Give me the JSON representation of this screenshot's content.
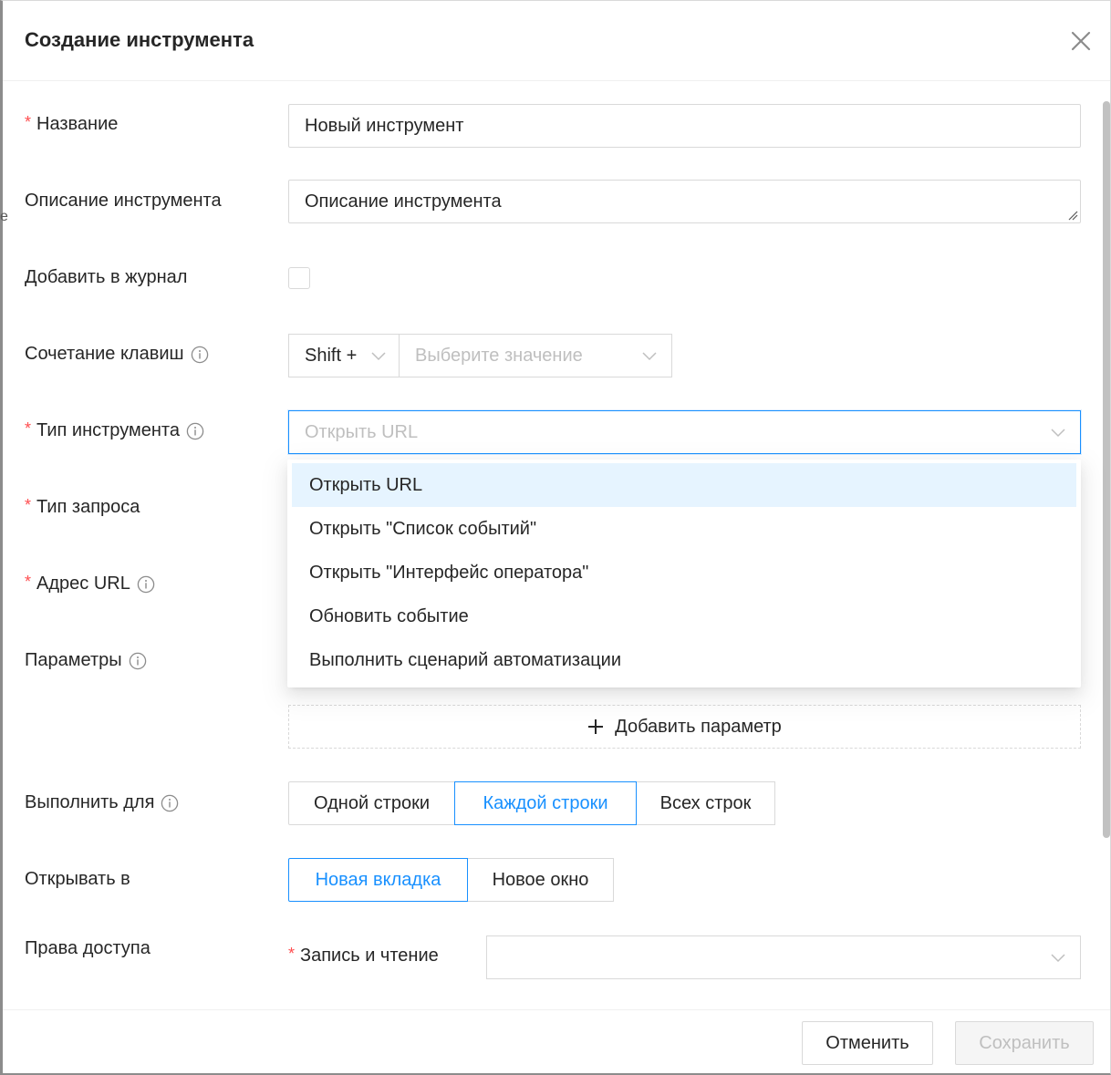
{
  "modal": {
    "title": "Создание инструмента"
  },
  "form": {
    "name": {
      "label": "Название",
      "value": "Новый инструмент"
    },
    "description": {
      "label": "Описание инструмента",
      "value": "Описание инструмента"
    },
    "add_to_log": {
      "label": "Добавить в журнал",
      "checked": false
    },
    "hotkey": {
      "label": "Сочетание клавиш",
      "modifier": "Shift +",
      "key_placeholder": "Выберите значение"
    },
    "tool_type": {
      "label": "Тип инструмента",
      "placeholder": "Открыть URL",
      "options": [
        "Открыть URL",
        "Открыть \"Список событий\"",
        "Открыть \"Интерфейс оператора\"",
        "Обновить событие",
        "Выполнить сценарий автоматизации"
      ],
      "highlighted_option": "Открыть URL"
    },
    "request_type": {
      "label": "Тип запроса"
    },
    "url": {
      "label": "Адрес URL"
    },
    "params": {
      "label": "Параметры",
      "add_button": "Добавить параметр"
    },
    "execute_for": {
      "label": "Выполнить для",
      "options": [
        "Одной строки",
        "Каждой строки",
        "Всех строк"
      ],
      "selected": "Каждой строки"
    },
    "open_in": {
      "label": "Открывать в",
      "options": [
        "Новая вкладка",
        "Новое окно"
      ],
      "selected": "Новая вкладка"
    },
    "access": {
      "label": "Права доступа",
      "write_read_label": "Запись и чтение",
      "value": ""
    }
  },
  "footer": {
    "cancel_label": "Отменить",
    "save_label": "Сохранить"
  },
  "colors": {
    "accent": "#1890ff",
    "required": "#ff4d4f",
    "border": "#d9d9d9",
    "active_option_bg": "#e6f4ff"
  }
}
